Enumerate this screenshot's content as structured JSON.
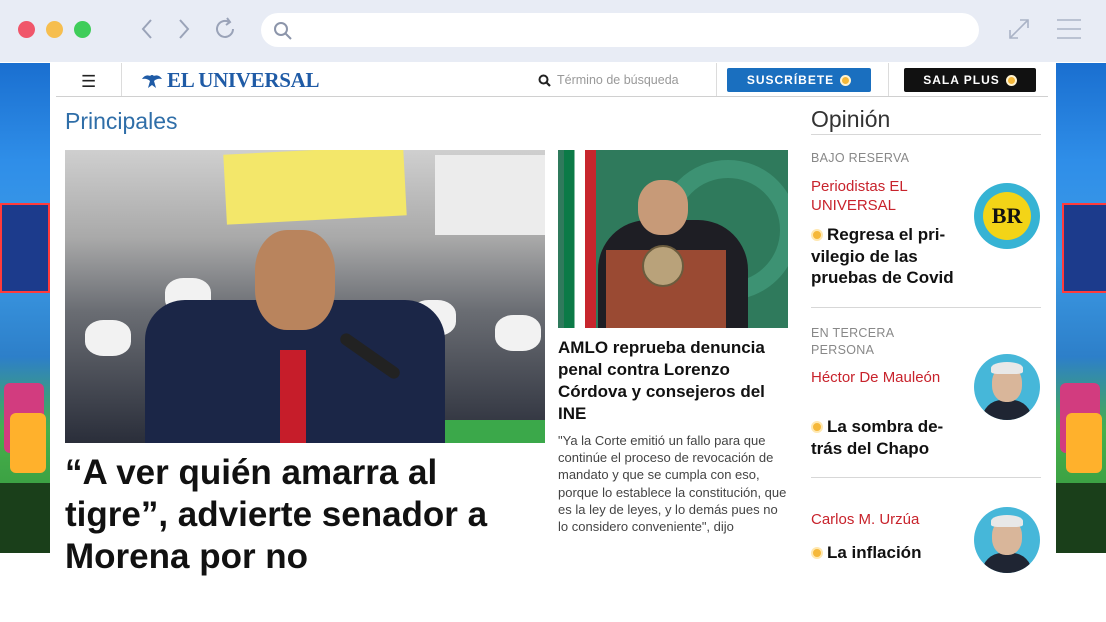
{
  "header": {
    "logo_text": "EL UNIVERSAL",
    "search_placeholder": "Término de búsqueda",
    "subscribe_label": "SUSCRÍBETE",
    "salaplus_label": "SALA PLUS"
  },
  "main": {
    "section_title": "Principales",
    "hero_headline": "“A ver quién amarra al tigre”, advierte senador a Morena por no",
    "mid_headline": "AMLO reprueba denuncia penal contra Lorenzo Córdova y consejeros del INE",
    "mid_summary": "\"Ya la Corte emitió un fallo para que continúe el proceso de revocación de mandato y que se cumpla con eso, porque lo establece la constitución, que es la ley de leyes, y lo demás pues no lo considero conveniente\", dijo"
  },
  "opinion": {
    "title": "Opinión",
    "items": [
      {
        "tag": "BAJO RESERVA",
        "author": "Periodistas EL UNIVERSAL",
        "headline": "Regresa el pri-vilegio de las pruebas de Covid",
        "avatar_text": "BR"
      },
      {
        "tag": "EN TERCERA PERSONA",
        "author": "Héctor De Mauleón",
        "headline": "La sombra de-trás del Chapo"
      },
      {
        "tag": "",
        "author": "Carlos M. Urzúa",
        "headline": "La inflación"
      }
    ]
  },
  "colors": {
    "brand_blue": "#1f5ba6",
    "subscribe_blue": "#1a6fbf",
    "author_red": "#c8232c",
    "coin_gold": "#f5b83a"
  }
}
